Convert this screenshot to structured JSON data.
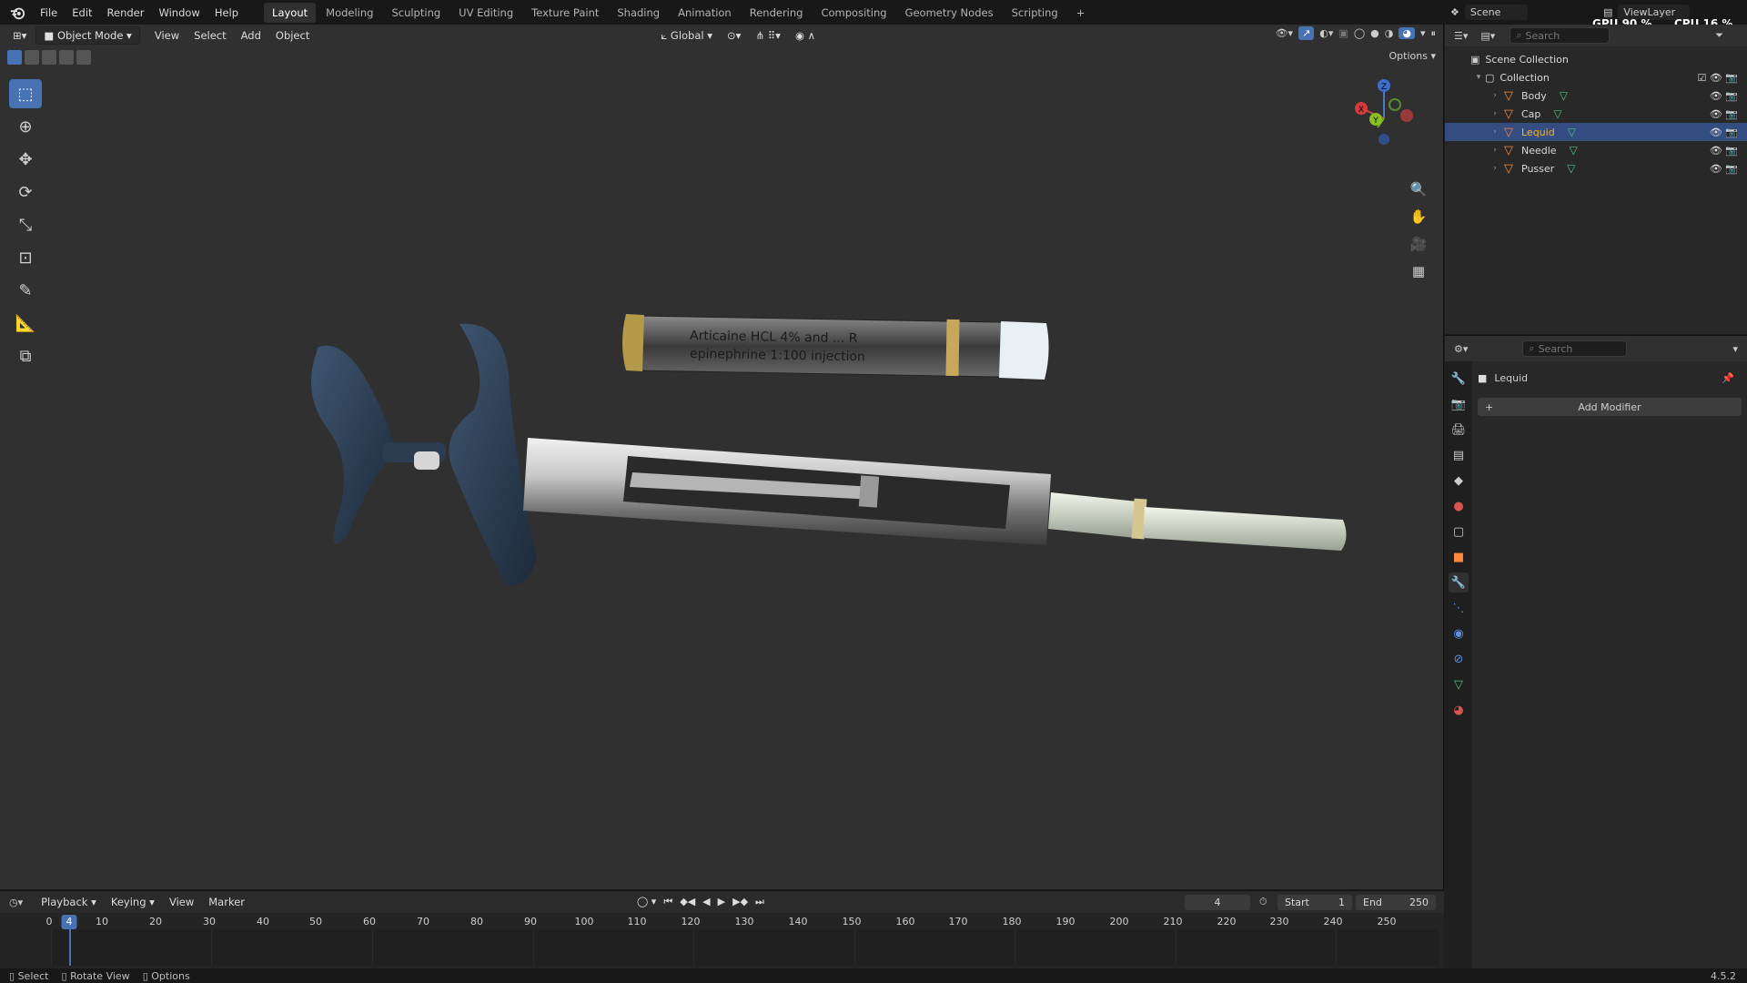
{
  "topbar": {
    "menus": [
      "File",
      "Edit",
      "Render",
      "Window",
      "Help"
    ],
    "workspaces": [
      "Layout",
      "Modeling",
      "Sculpting",
      "UV Editing",
      "Texture Paint",
      "Shading",
      "Animation",
      "Rendering",
      "Compositing",
      "Geometry Nodes",
      "Scripting"
    ],
    "active_workspace": "Layout",
    "add_tab": "+",
    "scene_name": "Scene",
    "view_layer": "ViewLayer",
    "gpu_label": "GPU",
    "gpu_value": "90 %",
    "cpu_label": "CPU",
    "cpu_value": "16 %"
  },
  "viewport": {
    "mode": "Object Mode",
    "menus": [
      "View",
      "Select",
      "Add",
      "Object"
    ],
    "orientation": "Global",
    "options_label": "Options",
    "object_label_1": "Articaine HCL 4% and ... R",
    "object_label_2": "epinephrine 1:100 injection",
    "gizmo": {
      "x": "X",
      "y": "Y",
      "z": "Z"
    }
  },
  "outliner": {
    "search_placeholder": "Search",
    "scene_collection": "Scene Collection",
    "collection": "Collection",
    "items": [
      {
        "name": "Body",
        "selected": false
      },
      {
        "name": "Cap",
        "selected": false
      },
      {
        "name": "Lequid",
        "selected": true
      },
      {
        "name": "Needle",
        "selected": false
      },
      {
        "name": "Pusser",
        "selected": false
      }
    ]
  },
  "properties": {
    "search_placeholder": "Search",
    "object_name": "Lequid",
    "add_modifier": "Add Modifier"
  },
  "timeline": {
    "menus": [
      "Playback",
      "Keying",
      "View",
      "Marker"
    ],
    "current_frame": "4",
    "start_label": "Start",
    "start_value": "1",
    "end_label": "End",
    "end_value": "250",
    "ticks": [
      "0",
      "10",
      "20",
      "30",
      "40",
      "50",
      "60",
      "70",
      "80",
      "90",
      "100",
      "110",
      "120",
      "130",
      "140",
      "150",
      "160",
      "170",
      "180",
      "190",
      "200",
      "210",
      "220",
      "230",
      "240",
      "250"
    ]
  },
  "statusbar": {
    "select": "Select",
    "rotate": "Rotate View",
    "options": "Options",
    "version": "4.5.2"
  }
}
